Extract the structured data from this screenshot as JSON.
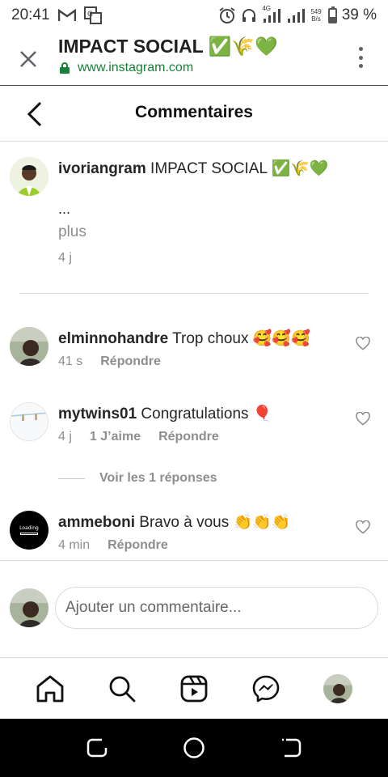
{
  "status_bar": {
    "time": "20:41",
    "net_type": "4G",
    "net_speed_value": "549",
    "net_speed_unit": "B/s",
    "battery_percent_label": "39 %",
    "battery_level": 0.39
  },
  "browser": {
    "title": "IMPACT SOCIAL ✅🌾💚",
    "url": "www.instagram.com"
  },
  "page": {
    "title": "Commentaires"
  },
  "caption": {
    "username": "ivoriangram",
    "text": " IMPACT SOCIAL ✅🌾💚",
    "ellipsis": "...",
    "more_label": "plus",
    "time": "4 j"
  },
  "comments": [
    {
      "username": "elminnohandre",
      "text": " Trop choux 🥰🥰🥰",
      "time": "41 s",
      "likes": "",
      "reply_label": "Répondre"
    },
    {
      "username": "mytwins01",
      "text": " Congratulations 🎈",
      "time": "4 j",
      "likes": "1 J’aime",
      "reply_label": "Répondre"
    },
    {
      "username": "ammeboni",
      "text": " Bravo à vous 👏👏👏",
      "time": "4 min",
      "likes": "",
      "reply_label": "Répondre",
      "avatar_text": "Loading"
    }
  ],
  "replies_toggle": "Voir les 1 réponses",
  "add_comment": {
    "placeholder": "Ajouter un commentaire..."
  },
  "colors": {
    "secure_green": "#188038",
    "muted": "#8e8e8e",
    "border": "#dbdbdb"
  },
  "icons": {
    "nav": [
      "home-icon",
      "search-icon",
      "reels-icon",
      "messenger-icon",
      "profile-avatar"
    ],
    "android": [
      "recents-icon",
      "home-circle-icon",
      "back-icon"
    ]
  }
}
